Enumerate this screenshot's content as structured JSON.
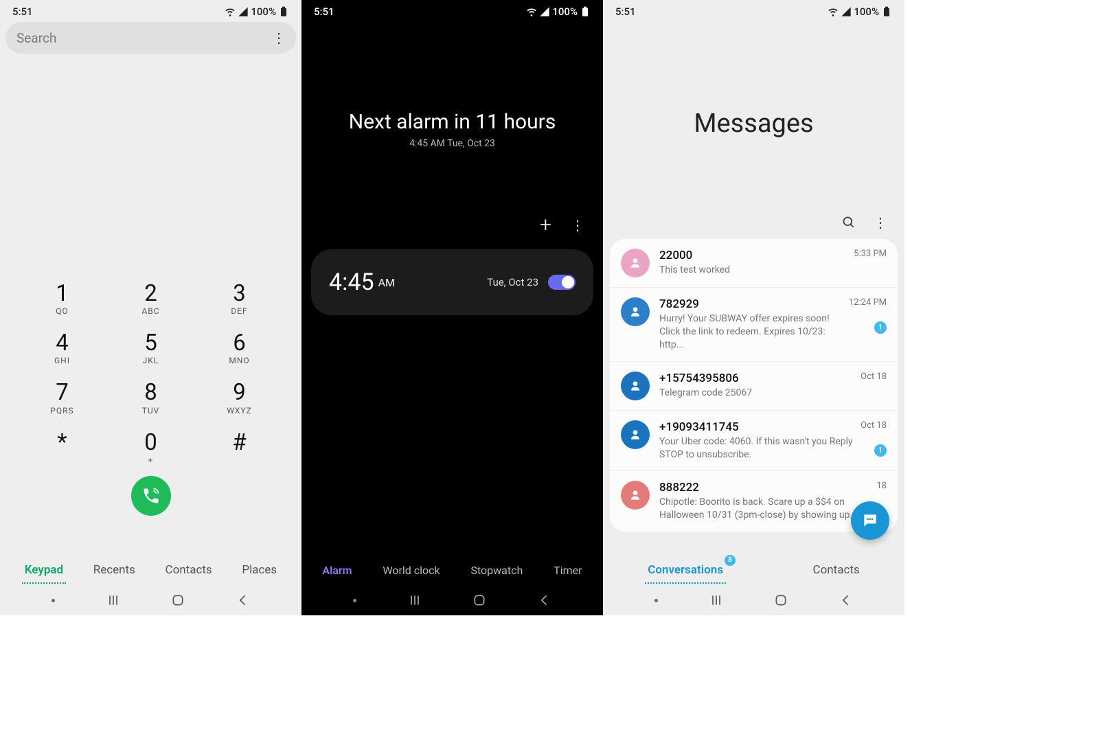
{
  "status": {
    "time": "5:51",
    "battery": "100%"
  },
  "phone": {
    "search_placeholder": "Search",
    "keys": [
      {
        "num": "1",
        "sub": "QO"
      },
      {
        "num": "2",
        "sub": "ABC"
      },
      {
        "num": "3",
        "sub": "DEF"
      },
      {
        "num": "4",
        "sub": "GHI"
      },
      {
        "num": "5",
        "sub": "JKL"
      },
      {
        "num": "6",
        "sub": "MNO"
      },
      {
        "num": "7",
        "sub": "PQRS"
      },
      {
        "num": "8",
        "sub": "TUV"
      },
      {
        "num": "9",
        "sub": "WXYZ"
      },
      {
        "num": "*",
        "sub": ""
      },
      {
        "num": "0",
        "sub": "+"
      },
      {
        "num": "#",
        "sub": ""
      }
    ],
    "tabs": [
      "Keypad",
      "Recents",
      "Contacts",
      "Places"
    ],
    "active_tab": "Keypad"
  },
  "clock": {
    "headline": "Next alarm in 11 hours",
    "subhead": "4:45 AM Tue, Oct 23",
    "alarm": {
      "time": "4:45",
      "ampm": "AM",
      "date": "Tue, Oct 23",
      "enabled": true
    },
    "tabs": [
      "Alarm",
      "World clock",
      "Stopwatch",
      "Timer"
    ],
    "active_tab": "Alarm"
  },
  "messages": {
    "title": "Messages",
    "items": [
      {
        "sender": "22000",
        "preview": "This test worked",
        "meta": "5:33 PM",
        "avatar": "#e9a5c3",
        "badge": null
      },
      {
        "sender": "782929",
        "preview": "Hurry! Your SUBWAY offer expires soon! Click the link to redeem. Expires 10/23: http...",
        "meta": "12:24 PM",
        "avatar": "#2d7fc9",
        "badge": "1"
      },
      {
        "sender": "+15754395806",
        "preview": "Telegram code 25067",
        "meta": "Oct 18",
        "avatar": "#1b73bf",
        "badge": null
      },
      {
        "sender": "+19093411745",
        "preview": "Your Uber code: 4060. If this wasn't you Reply STOP to unsubscribe.",
        "meta": "Oct 18",
        "avatar": "#1b73bf",
        "badge": "1"
      },
      {
        "sender": "888222",
        "preview": "Chipotle: Boorito is back. Scare up a $$4 on Halloween 10/31 (3pm-close) by showing up...",
        "meta": "18",
        "avatar": "#e47a7a",
        "badge": null
      }
    ],
    "tabs": {
      "conversations": "Conversations",
      "contacts": "Contacts",
      "count": "8"
    }
  }
}
